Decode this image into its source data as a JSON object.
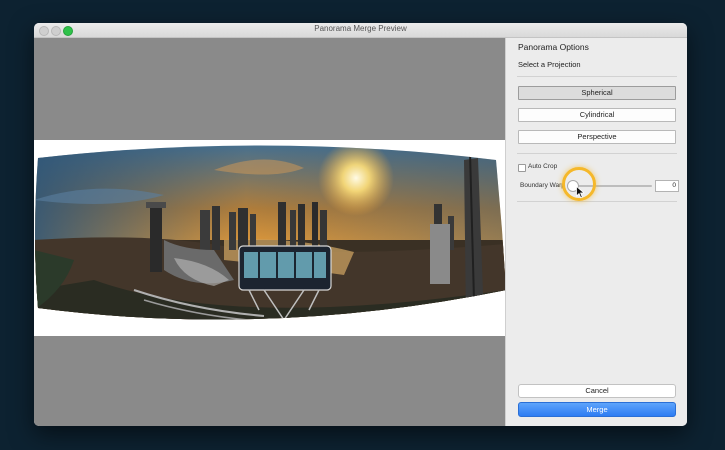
{
  "window": {
    "title": "Panorama Merge Preview"
  },
  "panel": {
    "title": "Panorama Options",
    "projection_heading": "Select a Projection",
    "projections": [
      {
        "label": "Spherical",
        "selected": true
      },
      {
        "label": "Cylindrical",
        "selected": false
      },
      {
        "label": "Perspective",
        "selected": false
      }
    ],
    "auto_crop": {
      "label": "Auto Crop",
      "checked": false
    },
    "boundary_warp": {
      "label": "Boundary Warp",
      "value": "0",
      "fraction": 0.0
    }
  },
  "actions": {
    "cancel_label": "Cancel",
    "merge_label": "Merge"
  },
  "colors": {
    "accent": "#2d7cf3",
    "highlight": "#f5b82a",
    "close_dot": "#2fc24a"
  }
}
